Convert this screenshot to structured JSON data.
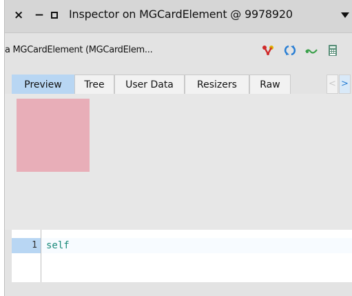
{
  "window": {
    "title": "Inspector on MGCardElement @ 9978920",
    "controls": {
      "close": "×",
      "minimize": "−"
    }
  },
  "header": {
    "object_label": "a MGCardElement (MGCardElem...",
    "icons": [
      "inspect-icon",
      "refresh-icon",
      "browse-icon",
      "calculator-icon"
    ]
  },
  "tabs": [
    {
      "label": "Preview",
      "active": true
    },
    {
      "label": "Tree",
      "active": false
    },
    {
      "label": "User Data",
      "active": false
    },
    {
      "label": "Resizers",
      "active": false
    },
    {
      "label": "Raw",
      "active": false
    }
  ],
  "tab_scroll": {
    "left": "<",
    "right": ">"
  },
  "preview": {
    "card_color": "#e8aeb8"
  },
  "editor": {
    "line_number": "1",
    "code": "self"
  },
  "colors": {
    "active_tab": "#b8d6f3",
    "code_text": "#1a8a7a",
    "icon_red": "#d02a2a",
    "icon_yellow": "#e0b000",
    "icon_blue": "#2a7fd4",
    "icon_green": "#3aa04a"
  }
}
